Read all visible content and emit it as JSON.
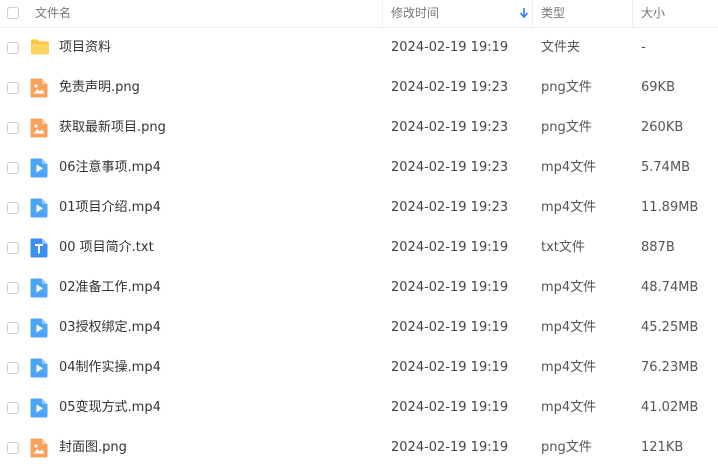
{
  "header": {
    "name": "文件名",
    "modified": "修改时间",
    "type": "类型",
    "size": "大小"
  },
  "colors": {
    "folder": "#FFC53D",
    "image": "#F7A35C",
    "video": "#4DA6F5",
    "text": "#3A8EF6",
    "sort_arrow": "#2F7CF6"
  },
  "files": [
    {
      "icon": "folder-icon",
      "name": "项目资料",
      "modified": "2024-02-19 19:19",
      "type": "文件夹",
      "size": "-"
    },
    {
      "icon": "image-file-icon",
      "name": "免责声明.png",
      "modified": "2024-02-19 19:23",
      "type": "png文件",
      "size": "69KB"
    },
    {
      "icon": "image-file-icon",
      "name": "获取最新项目.png",
      "modified": "2024-02-19 19:23",
      "type": "png文件",
      "size": "260KB"
    },
    {
      "icon": "video-file-icon",
      "name": "06注意事项.mp4",
      "modified": "2024-02-19 19:23",
      "type": "mp4文件",
      "size": "5.74MB"
    },
    {
      "icon": "video-file-icon",
      "name": "01项目介绍.mp4",
      "modified": "2024-02-19 19:23",
      "type": "mp4文件",
      "size": "11.89MB"
    },
    {
      "icon": "text-file-icon",
      "name": "00 项目简介.txt",
      "modified": "2024-02-19 19:19",
      "type": "txt文件",
      "size": "887B"
    },
    {
      "icon": "video-file-icon",
      "name": "02准备工作.mp4",
      "modified": "2024-02-19 19:19",
      "type": "mp4文件",
      "size": "48.74MB"
    },
    {
      "icon": "video-file-icon",
      "name": "03授权绑定.mp4",
      "modified": "2024-02-19 19:19",
      "type": "mp4文件",
      "size": "45.25MB"
    },
    {
      "icon": "video-file-icon",
      "name": "04制作实操.mp4",
      "modified": "2024-02-19 19:19",
      "type": "mp4文件",
      "size": "76.23MB"
    },
    {
      "icon": "video-file-icon",
      "name": "05变现方式.mp4",
      "modified": "2024-02-19 19:19",
      "type": "mp4文件",
      "size": "41.02MB"
    },
    {
      "icon": "image-file-icon",
      "name": "封面图.png",
      "modified": "2024-02-19 19:19",
      "type": "png文件",
      "size": "121KB"
    }
  ]
}
